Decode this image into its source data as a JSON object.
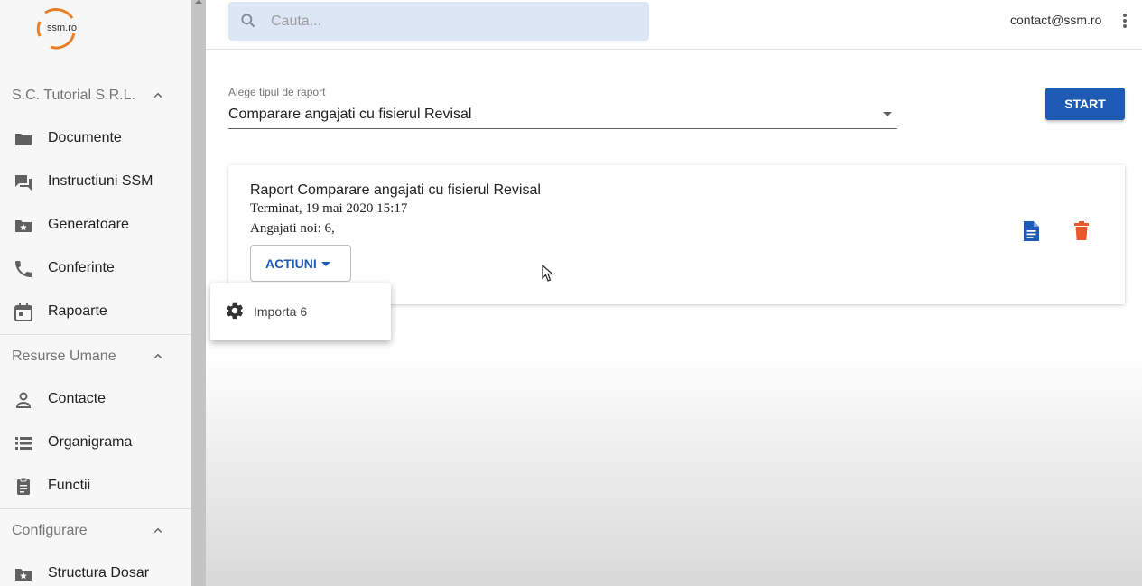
{
  "logo": {
    "text": "ssm.ro"
  },
  "sidebar": {
    "sections": [
      {
        "title": "S.C. Tutorial S.R.L.",
        "items": [
          {
            "label": "Documente",
            "icon": "folder-icon"
          },
          {
            "label": "Instructiuni SSM",
            "icon": "forum-icon"
          },
          {
            "label": "Generatoare",
            "icon": "folder-star-icon"
          },
          {
            "label": "Conferinte",
            "icon": "phone-icon"
          },
          {
            "label": "Rapoarte",
            "icon": "calendar-icon"
          }
        ]
      },
      {
        "title": "Resurse Umane",
        "items": [
          {
            "label": "Contacte",
            "icon": "person-icon"
          },
          {
            "label": "Organigrama",
            "icon": "list-icon"
          },
          {
            "label": "Functii",
            "icon": "clipboard-icon"
          }
        ]
      },
      {
        "title": "Configurare",
        "items": [
          {
            "label": "Structura Dosar",
            "icon": "folder-star-icon"
          }
        ]
      }
    ]
  },
  "topbar": {
    "search_placeholder": "Cauta...",
    "user_email": "contact@ssm.ro"
  },
  "report_form": {
    "select_label": "Alege tipul de raport",
    "selected_value": "Comparare angajati cu fisierul Revisal",
    "start_label": "START"
  },
  "report_card": {
    "title": "Raport Comparare angajati cu fisierul Revisal",
    "status": "Terminat, 19 mai 2020 15:17",
    "count": "Angajati noi: 6,",
    "actions_label": "ACTIUNI"
  },
  "actions_menu": {
    "items": [
      {
        "label": "Importa 6",
        "icon": "gear-icon"
      }
    ]
  },
  "colors": {
    "accent": "#1e5bb4",
    "delete": "#e8592b",
    "logo_orange": "#e8802b"
  }
}
